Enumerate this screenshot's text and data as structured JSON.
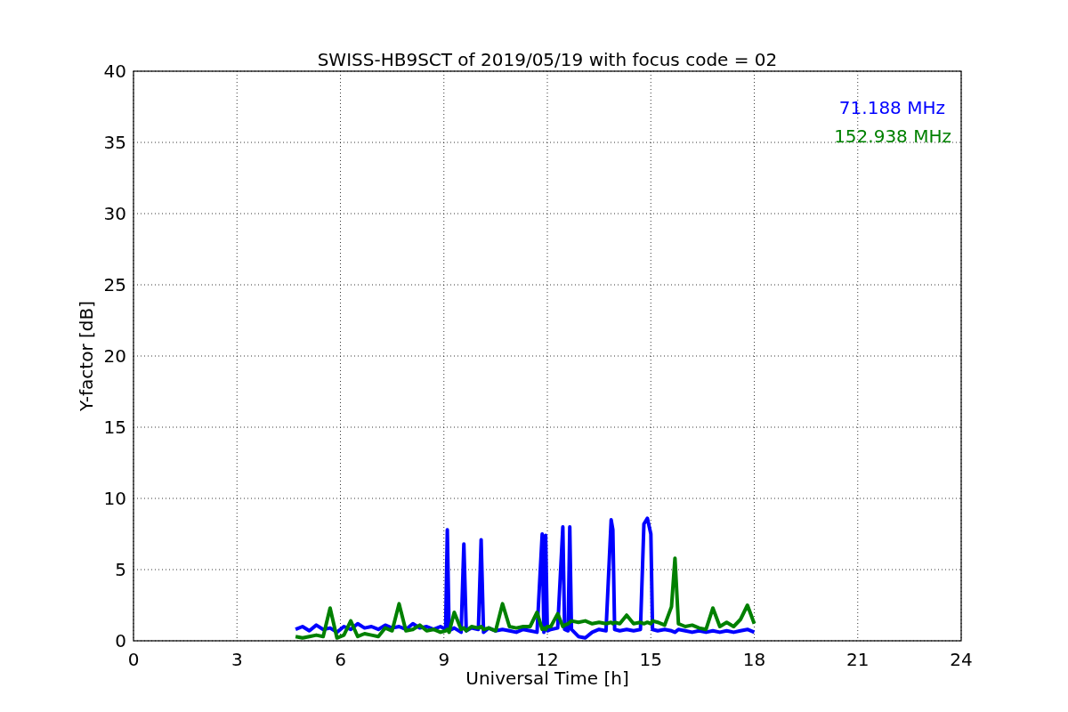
{
  "chart_data": {
    "type": "line",
    "title": "SWISS-HB9SCT of 2019/05/19 with focus code = 02",
    "xlabel": "Universal Time [h]",
    "ylabel": "Y-factor [dB]",
    "x": [
      4.7,
      4.9,
      5.1,
      5.3,
      5.5,
      5.7,
      5.9,
      6.1,
      6.3,
      6.5,
      6.7,
      6.9,
      7.1,
      7.3,
      7.5,
      7.7,
      7.9,
      8.1,
      8.3,
      8.5,
      8.7,
      8.9,
      9.05,
      9.1,
      9.15,
      9.3,
      9.5,
      9.58,
      9.65,
      9.8,
      10.0,
      10.08,
      10.15,
      10.3,
      10.5,
      10.7,
      10.9,
      11.1,
      11.3,
      11.5,
      11.7,
      11.85,
      11.9,
      11.95,
      12.0,
      12.1,
      12.3,
      12.45,
      12.5,
      12.6,
      12.65,
      12.7,
      12.9,
      13.1,
      13.3,
      13.5,
      13.7,
      13.85,
      13.9,
      13.95,
      14.1,
      14.3,
      14.5,
      14.7,
      14.8,
      14.9,
      15.0,
      15.05,
      15.2,
      15.4,
      15.6,
      15.7,
      15.8,
      16.0,
      16.2,
      16.4,
      16.6,
      16.8,
      17.0,
      17.2,
      17.4,
      17.6,
      17.8,
      18.0
    ],
    "series": [
      {
        "name": "71.188 MHz",
        "color": "#0000ff",
        "values": [
          0.8,
          1.0,
          0.7,
          1.1,
          0.8,
          0.9,
          0.6,
          1.0,
          0.8,
          1.2,
          0.9,
          1.0,
          0.8,
          1.1,
          0.9,
          1.0,
          0.8,
          1.2,
          0.9,
          1.0,
          0.8,
          1.0,
          0.8,
          7.8,
          0.7,
          0.9,
          0.6,
          6.8,
          0.7,
          0.9,
          0.8,
          7.1,
          0.6,
          0.9,
          0.7,
          0.8,
          0.7,
          0.6,
          0.8,
          0.7,
          0.6,
          7.5,
          0.6,
          7.4,
          0.7,
          0.8,
          0.9,
          8.0,
          0.8,
          0.7,
          8.0,
          0.8,
          0.3,
          0.2,
          0.6,
          0.8,
          0.7,
          8.5,
          7.8,
          0.8,
          0.7,
          0.8,
          0.7,
          0.8,
          8.2,
          8.6,
          7.5,
          0.8,
          0.7,
          0.8,
          0.7,
          0.6,
          0.8,
          0.7,
          0.6,
          0.7,
          0.6,
          0.7,
          0.6,
          0.7,
          0.6,
          0.7,
          0.8,
          0.6
        ]
      },
      {
        "name": "152.938 MHz",
        "color": "#008000",
        "values": [
          0.3,
          0.2,
          0.3,
          0.4,
          0.3,
          2.3,
          0.2,
          0.4,
          1.4,
          0.3,
          0.5,
          0.4,
          0.3,
          0.9,
          0.7,
          2.6,
          0.7,
          0.8,
          1.1,
          0.7,
          0.8,
          0.6,
          0.7,
          0.8,
          0.6,
          2.0,
          0.8,
          0.9,
          0.7,
          1.0,
          0.9,
          1.0,
          0.8,
          0.9,
          0.7,
          2.6,
          1.0,
          0.9,
          1.0,
          1.0,
          2.0,
          0.8,
          0.9,
          0.8,
          1.0,
          1.0,
          1.9,
          1.0,
          1.1,
          1.2,
          1.3,
          1.4,
          1.3,
          1.4,
          1.2,
          1.3,
          1.2,
          1.3,
          1.2,
          1.3,
          1.2,
          1.8,
          1.2,
          1.3,
          1.2,
          1.3,
          1.2,
          1.4,
          1.3,
          1.1,
          2.4,
          5.8,
          1.2,
          1.0,
          1.1,
          0.9,
          0.8,
          2.3,
          1.0,
          1.3,
          1.0,
          1.5,
          2.5,
          1.2
        ]
      }
    ],
    "grid": true,
    "xlim": [
      0,
      24
    ],
    "ylim": [
      0,
      40
    ],
    "xticks": [
      0,
      3,
      6,
      9,
      12,
      15,
      18,
      21,
      24
    ],
    "yticks": [
      0,
      5,
      10,
      15,
      20,
      25,
      30,
      35,
      40
    ]
  }
}
